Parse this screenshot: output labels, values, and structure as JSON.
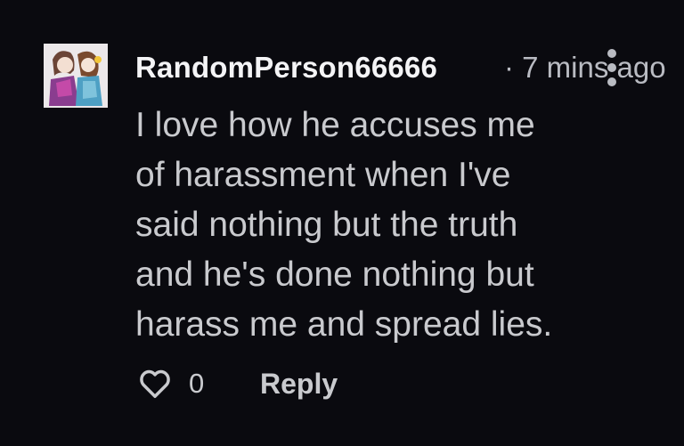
{
  "comment": {
    "username": "RandomPerson66666",
    "meta": "· 7 mins ago",
    "lines": [
      "I love how he accuses me",
      "of harassment when I've",
      "said nothing but the truth",
      "and he's done nothing but",
      "harass me and spread lies."
    ],
    "like_count": "0",
    "reply_label": "Reply"
  },
  "icons": {
    "like": "heart-outline-icon",
    "more": "vertical-dots-icon"
  },
  "colors": {
    "background": "#0a0a0f",
    "username": "#f4f4f6",
    "text": "#c9cace",
    "muted": "#b9bbc2"
  }
}
